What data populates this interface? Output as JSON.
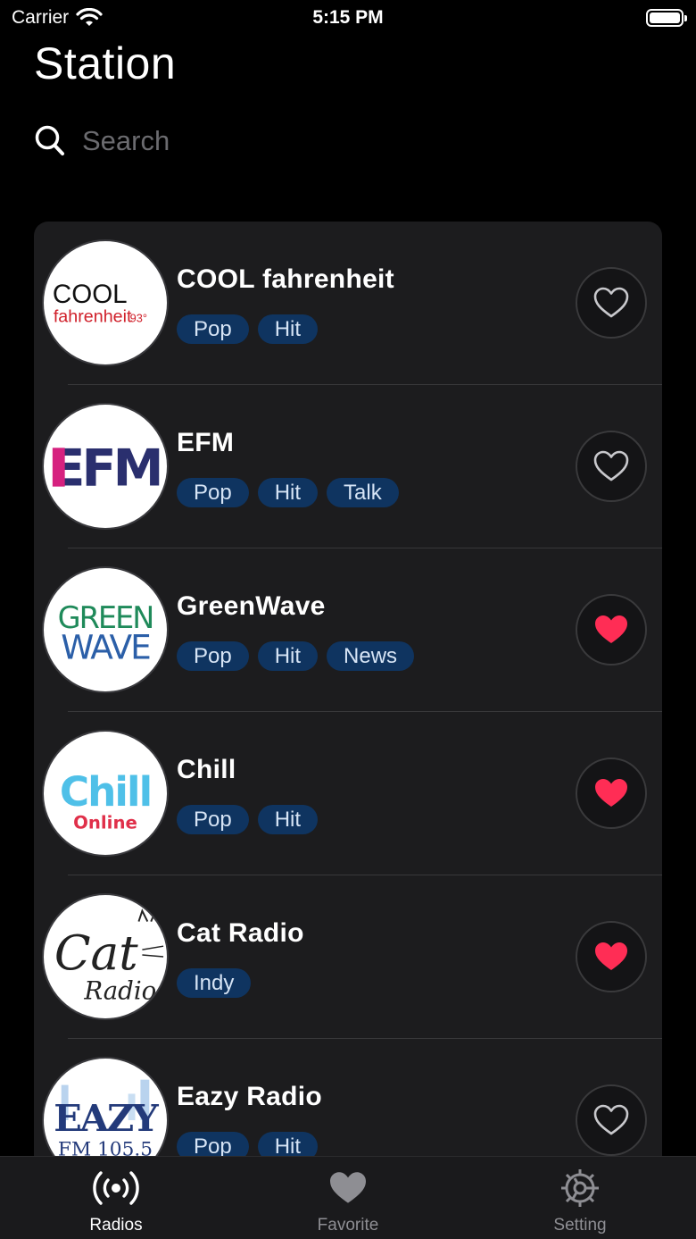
{
  "status_bar": {
    "carrier": "Carrier",
    "time": "5:15 PM"
  },
  "header": {
    "title": "Station"
  },
  "search": {
    "placeholder": "Search"
  },
  "stations": [
    {
      "name": "COOL fahrenheit",
      "tags": [
        "Pop",
        "Hit"
      ],
      "favorite": false,
      "logo": {
        "line1": "COOL",
        "line2": "fahrenheit",
        "line3": "93°"
      }
    },
    {
      "name": "EFM",
      "tags": [
        "Pop",
        "Hit",
        "Talk"
      ],
      "favorite": false,
      "logo": {
        "line1": "EFM"
      }
    },
    {
      "name": "GreenWave",
      "tags": [
        "Pop",
        "Hit",
        "News"
      ],
      "favorite": true,
      "logo": {
        "line1": "GREEN",
        "line2": "WAVE"
      }
    },
    {
      "name": "Chill",
      "tags": [
        "Pop",
        "Hit"
      ],
      "favorite": true,
      "logo": {
        "line1": "Chill",
        "line2": "Online"
      }
    },
    {
      "name": "Cat Radio",
      "tags": [
        "Indy"
      ],
      "favorite": true,
      "logo": {
        "line1": "Cat",
        "line2": "Radio"
      }
    },
    {
      "name": "Eazy Radio",
      "tags": [
        "Pop",
        "Hit"
      ],
      "favorite": false,
      "logo": {
        "line1": "EAZY",
        "line2": "FM 105.5"
      }
    }
  ],
  "tab_bar": {
    "tabs": [
      {
        "label": "Radios",
        "icon": "radio-waves-icon",
        "active": true
      },
      {
        "label": "Favorite",
        "icon": "heart-icon",
        "active": false
      },
      {
        "label": "Setting",
        "icon": "gear-icon",
        "active": false
      }
    ]
  },
  "colors": {
    "accent_favorite": "#ff2d55",
    "tag_bg": "#0f3460",
    "card_bg": "#1c1c1e"
  }
}
